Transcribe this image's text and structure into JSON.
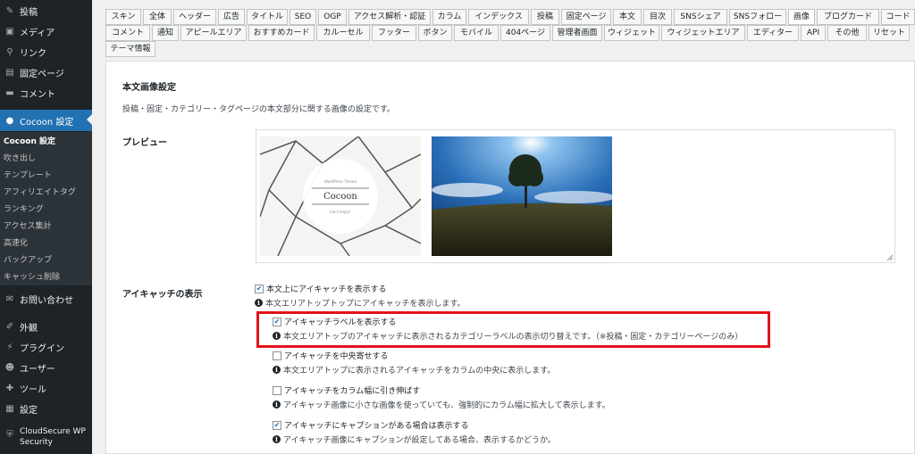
{
  "sidebar": {
    "items": [
      {
        "label": "投稿",
        "icon": "pin-icon"
      },
      {
        "label": "メディア",
        "icon": "media-icon"
      },
      {
        "label": "リンク",
        "icon": "link-icon"
      },
      {
        "label": "固定ページ",
        "icon": "page-icon"
      },
      {
        "label": "コメント",
        "icon": "comment-icon"
      },
      {
        "label": "Cocoon 設定",
        "icon": "cocoon-icon"
      },
      {
        "label": "お問い合わせ",
        "icon": "mail-icon"
      },
      {
        "label": "外観",
        "icon": "brush-icon"
      },
      {
        "label": "プラグイン",
        "icon": "plugin-icon"
      },
      {
        "label": "ユーザー",
        "icon": "user-icon"
      },
      {
        "label": "ツール",
        "icon": "wrench-icon"
      },
      {
        "label": "設定",
        "icon": "settings-icon"
      },
      {
        "label": "CloudSecure WP",
        "label2": "Security",
        "icon": "shield-icon"
      }
    ],
    "submenu": [
      "Cocoon 設定",
      "吹き出し",
      "テンプレート",
      "アフィリエイトタグ",
      "ランキング",
      "アクセス集計",
      "高速化",
      "バックアップ",
      "キャッシュ削除"
    ]
  },
  "tabs": {
    "row1": [
      "スキン",
      "全体",
      "ヘッダー",
      "広告",
      "タイトル",
      "SEO",
      "OGP",
      "アクセス解析・認証",
      "カラム",
      "インデックス",
      "投稿",
      "固定ページ",
      "本文",
      "目次",
      "SNSシェア",
      "SNSフォロー",
      "画像",
      "ブログカード",
      "コード"
    ],
    "row2": [
      "コメント",
      "通知",
      "アピールエリア",
      "おすすめカード",
      "カルーセル",
      "フッター",
      "ボタン",
      "モバイル",
      "404ページ",
      "管理者画面",
      "ウィジェット",
      "ウィジェットエリア",
      "エディター",
      "API",
      "その他",
      "リセット"
    ],
    "row3": [
      "テーマ情報"
    ],
    "selected": "画像"
  },
  "panel": {
    "title": "本文画像設定",
    "description": "投稿・固定・カテゴリー・タグページの本文部分に関する画像の設定です。",
    "preview_label": "プレビュー",
    "preview_logo_small": "WordPress Theme",
    "preview_logo": "Cocoon",
    "preview_logo_sub": "Let's enjoy!",
    "eyecatch_label": "アイキャッチの表示",
    "options": [
      {
        "label": "本文上にアイキャッチを表示する",
        "checked": true,
        "note": "本文エリアトップトップにアイキャッチを表示します。"
      },
      {
        "label": "アイキャッチラベルを表示する",
        "checked": true,
        "note": "本文エリアトップのアイキャッチに表示されるカテゴリーラベルの表示切り替えです。（※投稿・固定・カテゴリーページのみ）"
      },
      {
        "label": "アイキャッチを中央寄せする",
        "checked": false,
        "note": "本文エリアトップに表示されるアイキャッチをカラムの中央に表示します。"
      },
      {
        "label": "アイキャッチをカラム幅に引き伸ばす",
        "checked": false,
        "note": "アイキャッチ画像に小さな画像を使っていても、強制的にカラム幅に拡大して表示します。"
      },
      {
        "label": "アイキャッチにキャプションがある場合は表示する",
        "checked": true,
        "note": "アイキャッチ画像にキャプションが設定してある場合、表示するかどうか。"
      }
    ]
  },
  "colors": {
    "accent": "#2271b1",
    "highlight": "#e0141b",
    "sidebar": "#1d2327"
  }
}
